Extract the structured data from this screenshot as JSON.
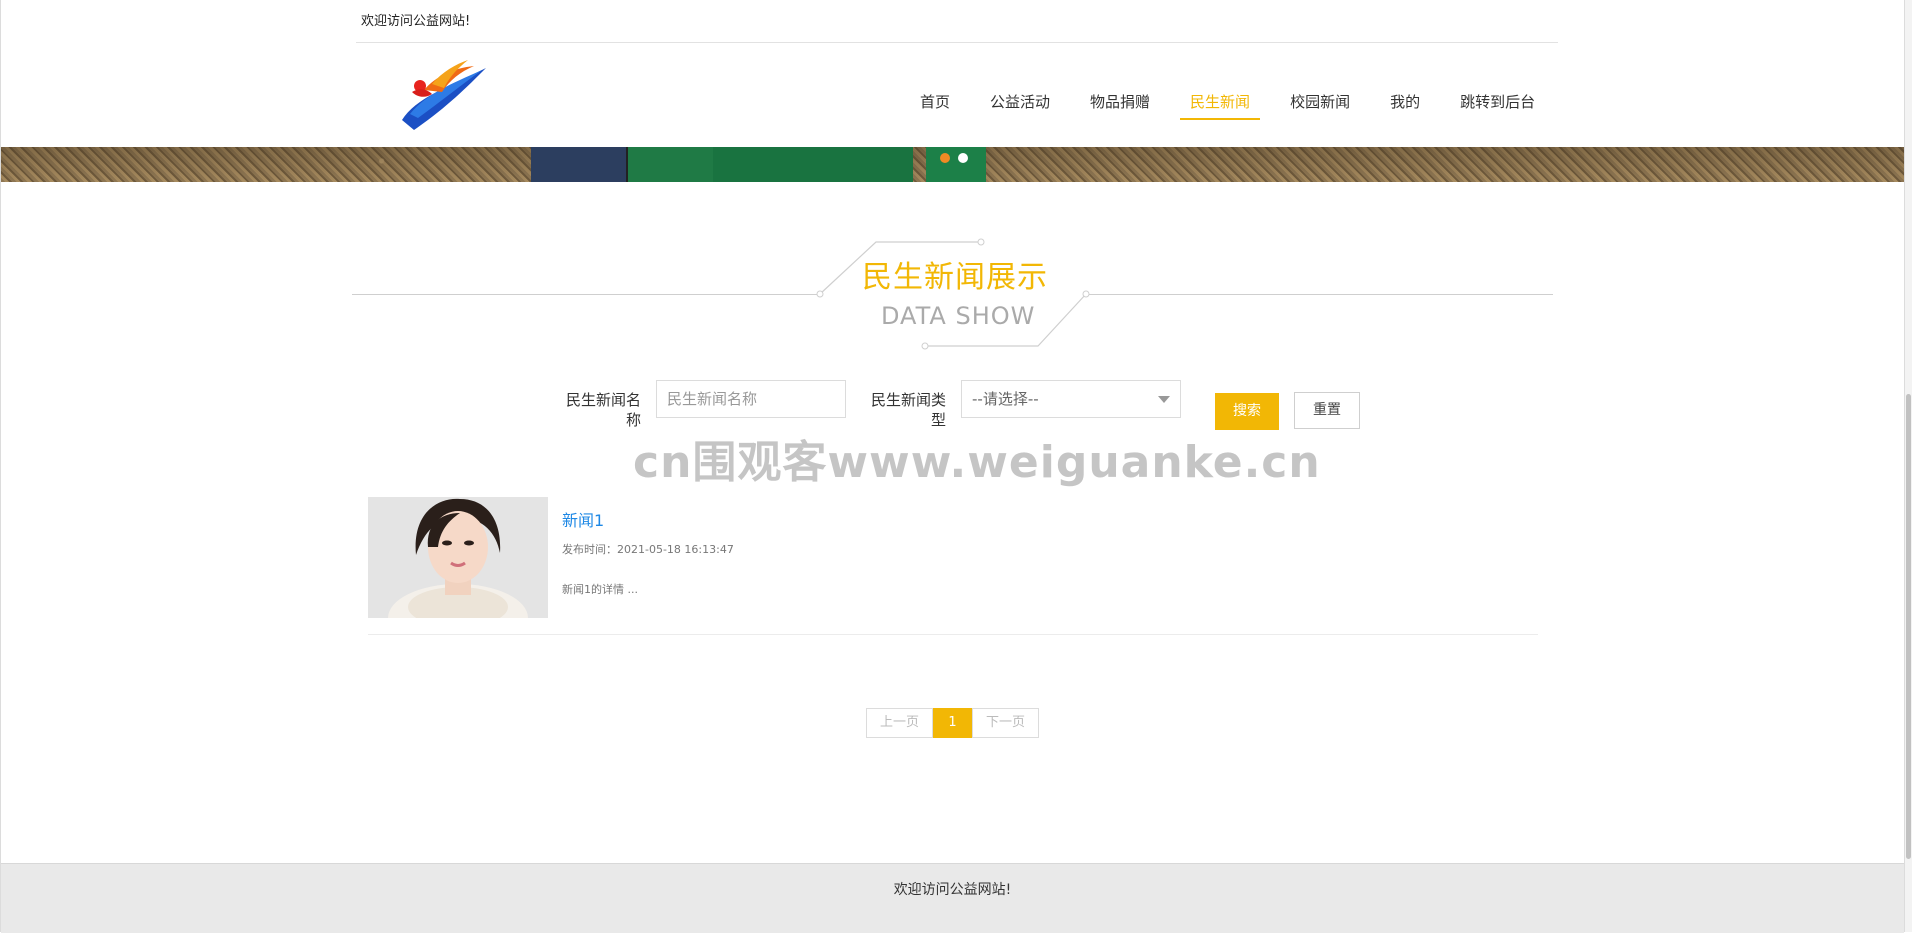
{
  "header": {
    "welcome": "欢迎访问公益网站!"
  },
  "nav": {
    "items": [
      {
        "label": "首页",
        "active": false
      },
      {
        "label": "公益活动",
        "active": false
      },
      {
        "label": "物品捐赠",
        "active": false
      },
      {
        "label": "民生新闻",
        "active": true
      },
      {
        "label": "校园新闻",
        "active": false
      },
      {
        "label": "我的",
        "active": false
      },
      {
        "label": "跳转到后台",
        "active": false
      }
    ]
  },
  "section": {
    "title": "民生新闻展示",
    "subtitle": "DATA SHOW"
  },
  "search": {
    "name_label": "民生新闻名称",
    "name_placeholder": "民生新闻名称",
    "type_label": "民生新闻类型",
    "type_selected": "--请选择--",
    "search_button": "搜索",
    "reset_button": "重置"
  },
  "watermark": "cn围观客www.weiguanke.cn",
  "news": [
    {
      "title": "新闻1",
      "time_label": "发布时间：",
      "time": "2021-05-18 16:13:47",
      "desc": "新闻1的详情 ..."
    }
  ],
  "pager": {
    "prev": "上一页",
    "current": "1",
    "next": "下一页"
  },
  "footer": {
    "text": "欢迎访问公益网站!"
  },
  "colors": {
    "accent": "#f2b705",
    "link": "#1e88e5",
    "footer_bg": "#e9e9e9"
  }
}
